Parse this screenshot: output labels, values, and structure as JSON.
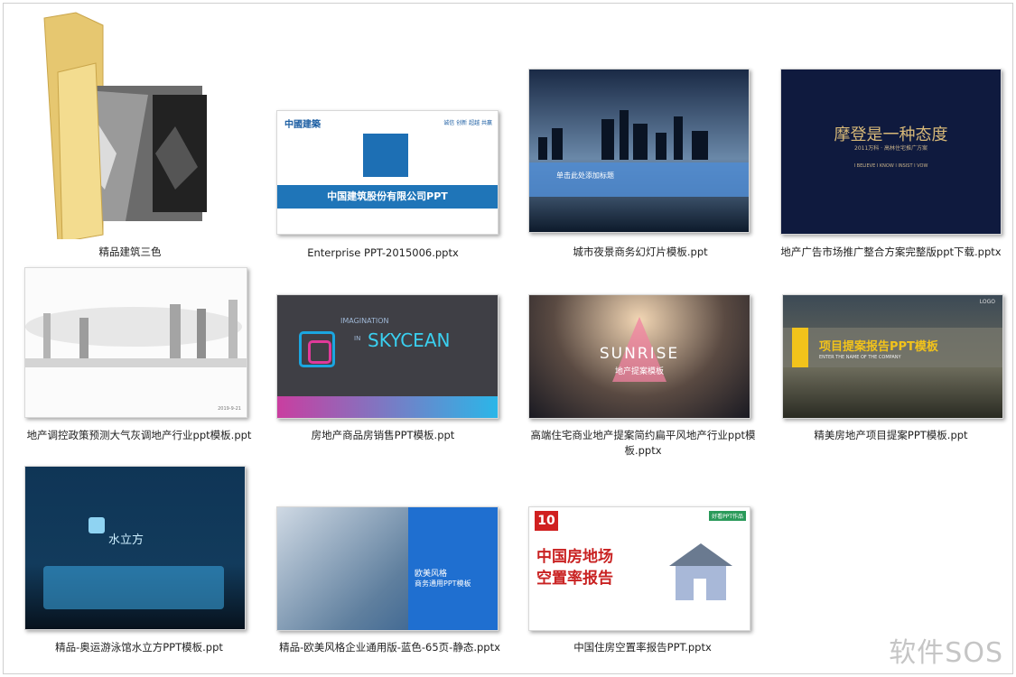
{
  "items": [
    {
      "label": "精品建筑三色",
      "type": "folder"
    },
    {
      "label": "Enterprise PPT-2015006.pptx",
      "type": "file",
      "brand": "中國建築",
      "company": "中国建筑股份有限公司PPT",
      "nav": "诚信 创新 超越 共赢"
    },
    {
      "label": "城市夜景商务幻灯片模板.ppt",
      "type": "file",
      "caption": "单击此处添加标题"
    },
    {
      "label": "地产广告市场推广整合方案完整版ppt下载.pptx",
      "type": "file",
      "title": "摩登是一种态度",
      "subtitle": "2011万科 · 高林住宅推广方案",
      "tagline": "I BELIEVE   I KNOW   I INSIST   I VOW"
    },
    {
      "label": "地产调控政策预测大气灰调地产行业ppt模板.ppt",
      "type": "file",
      "footer": "2019-9-21"
    },
    {
      "label": "房地产商品房销售PPT模板.ppt",
      "type": "file",
      "small": "IMAGINATION",
      "big": "SKYCEAN",
      "prefix": "IN"
    },
    {
      "label": "高端住宅商业地产提案简约扁平风地产行业ppt模板.pptx",
      "type": "file",
      "title": "SUNRISE",
      "subtitle": "地产提案模板"
    },
    {
      "label": "精美房地产项目提案PPT模板.ppt",
      "type": "file",
      "title": "项目提案报告PPT模板",
      "logo": "LOGO",
      "sub": "ENTER THE NAME OF THE COMPANY"
    },
    {
      "label": "精品-奥运游泳馆水立方PPT模板.ppt",
      "type": "file",
      "title": "水立方"
    },
    {
      "label": "精品-欧美风格企业通用版-蓝色-65页-静态.pptx",
      "type": "file",
      "title": "欧美风格",
      "subtitle": "商务通用PPT模板"
    },
    {
      "label": "中国住房空置率报告PPT.pptx",
      "type": "file",
      "badge": "10",
      "corner": "好看PPT作品",
      "title1": "中国房地场",
      "title2": "空置率报告"
    }
  ],
  "watermark": "软件SOS"
}
